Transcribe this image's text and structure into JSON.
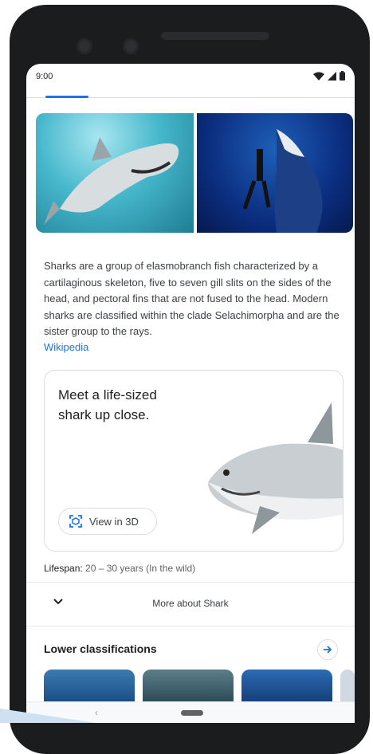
{
  "status": {
    "time": "9:00"
  },
  "images": [
    "Shark swimming",
    "Diver with shark"
  ],
  "description": "Sharks are a group of elasmobranch fish characterized by a cartilaginous skeleton, five to seven gill slits on the sides of the head, and pectoral fins that are not fused to the head. Modern sharks are classified within the clade Selachimorpha and are the sister group to the rays.",
  "source_link": "Wikipedia",
  "card3d": {
    "title": "Meet a life-sized shark up close.",
    "button_label": "View in 3D"
  },
  "lifespan": {
    "label": "Lifespan:",
    "value": "20 – 30 years (In the wild)"
  },
  "more": {
    "label": "More about Shark"
  },
  "lower": {
    "title": "Lower classifications"
  },
  "nav": {
    "back": "‹"
  },
  "colors": {
    "accent": "#1a73e8",
    "text": "#202124"
  }
}
